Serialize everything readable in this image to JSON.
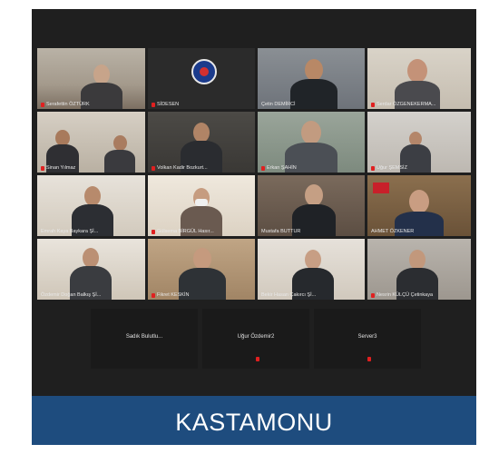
{
  "participants": [
    {
      "name": "Serafettin ÖZTÜRK"
    },
    {
      "name": "SİDESEN"
    },
    {
      "name": "Çetin DEMİRCİ"
    },
    {
      "name": "Serdar ÖZGENEKERMA..."
    },
    {
      "name": "Sinan Yılmaz"
    },
    {
      "name": "Volkan Kadir Bozkurt..."
    },
    {
      "name": "Erkan ŞAHİN"
    },
    {
      "name": "Uğur ŞEMSİZ"
    },
    {
      "name": "Emrah Kaya Baykara Şİ..."
    },
    {
      "name": "Gülsema BİRGÜL Hasır..."
    },
    {
      "name": "Mustafa BUTTUR"
    },
    {
      "name": "AHMET ÖZKENER"
    },
    {
      "name": "Özdemir Doğan Balkış Şİ..."
    },
    {
      "name": "Fikret KESKİN"
    },
    {
      "name": "Bekir Hasan Çakırcı Şİ..."
    },
    {
      "name": "Nesrin KÜLÇÜ Çetinkaya"
    }
  ],
  "audio_only": [
    {
      "name": "Sadık Bulutlu..."
    },
    {
      "name": "Uğur Özdemir2"
    },
    {
      "name": "Server3"
    }
  ],
  "footer": {
    "title": "KASTAMONU"
  },
  "colors": {
    "active_outline": "#c8e06a",
    "footer_bg": "#1e4c7e",
    "muted_mic": "#e02020"
  }
}
